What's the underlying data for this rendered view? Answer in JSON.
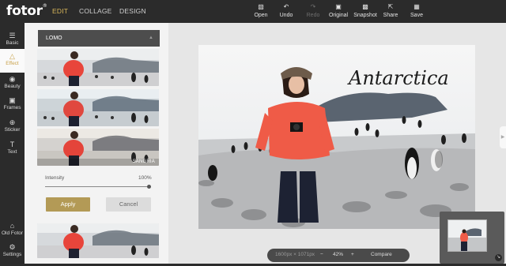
{
  "app": {
    "logo": "fotor",
    "logo_mark": "®",
    "nav": {
      "edit": "EDIT",
      "collage": "COLLAGE",
      "design": "DESIGN"
    }
  },
  "toolbar": {
    "open": {
      "label": "Open",
      "icon": "folder-icon"
    },
    "undo": {
      "label": "Undo",
      "icon": "undo-icon"
    },
    "redo": {
      "label": "Redo",
      "icon": "redo-icon"
    },
    "original": {
      "label": "Original",
      "icon": "image-icon"
    },
    "snapshot": {
      "label": "Snapshot",
      "icon": "snapshot-icon"
    },
    "share": {
      "label": "Share",
      "icon": "share-icon"
    },
    "save": {
      "label": "Save",
      "icon": "save-icon"
    }
  },
  "sidebar": {
    "items": [
      {
        "label": "Basic",
        "icon": "sliders-icon"
      },
      {
        "label": "Effect",
        "icon": "flask-icon",
        "active": true
      },
      {
        "label": "Beauty",
        "icon": "eye-icon"
      },
      {
        "label": "Frames",
        "icon": "frame-icon"
      },
      {
        "label": "Sticker",
        "icon": "plus-circle-icon"
      },
      {
        "label": "Text",
        "icon": "text-icon"
      },
      {
        "label": "Old Fotor",
        "icon": "home-icon"
      },
      {
        "label": "Settings",
        "icon": "gear-icon"
      }
    ]
  },
  "panel": {
    "category": "LOMO",
    "filters": [
      {
        "label": ""
      },
      {
        "label": ""
      },
      {
        "label": "SANGRIA"
      },
      {
        "label": ""
      }
    ],
    "intensity_label": "Intensity",
    "intensity_value": "100%",
    "intensity": 1.0,
    "apply_label": "Apply",
    "cancel_label": "Cancel"
  },
  "canvas": {
    "photo_caption": "Antarctica",
    "size_readout": "1600px × 1071px",
    "zoom_minus": "−",
    "zoom_level": "42%",
    "zoom_plus": "+",
    "compare_label": "Compare"
  },
  "colors": {
    "accent": "#c9a24b",
    "apply_button": "#b39a56",
    "topbar": "#2b2b2b"
  }
}
